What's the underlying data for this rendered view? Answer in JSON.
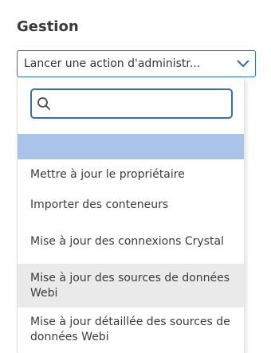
{
  "section": {
    "title": "Gestion"
  },
  "action_select": {
    "value": "Lancer une action d'administr..."
  },
  "dropdown": {
    "search": {
      "value": "",
      "placeholder": ""
    },
    "options": [
      {
        "label": "",
        "state": "selected"
      },
      {
        "label": "Mettre à jour le propriétaire"
      },
      {
        "label": "Importer des conteneurs"
      },
      {
        "label": "Mise à jour des connexions Crystal"
      },
      {
        "label": "Mise à jour des sources de données Webi",
        "state": "hover"
      },
      {
        "label": "Mise à jour détaillée des sources de données Webi"
      }
    ]
  },
  "colors": {
    "accent": "#2c6fb7",
    "selected_option": "#a9c4e8",
    "hover_option": "#eaeaea",
    "text": "#3b3b3b"
  },
  "icons": {
    "combo": "chevron-down-icon",
    "search": "search-icon"
  }
}
